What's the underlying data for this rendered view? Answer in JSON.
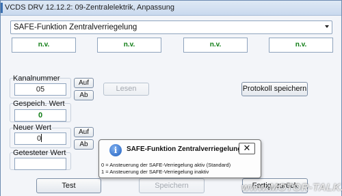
{
  "window": {
    "title": "VCDS DRV 12.12.2: 09-Zentralelektrik,  Anpassung"
  },
  "channel_select": {
    "value": "SAFE-Funktion Zentralverriegelung"
  },
  "nv_fields": [
    "n.v.",
    "n.v.",
    "n.v.",
    "n.v."
  ],
  "kanal": {
    "label": "Kanalnummer",
    "value": "05",
    "up_label": "Auf",
    "down_label": "Ab",
    "lesen_label": "Lesen"
  },
  "gespeich": {
    "label": "Gespeich. Wert",
    "value": "0"
  },
  "neuer": {
    "label": "Neuer Wert",
    "value": "0",
    "up_label": "Auf",
    "down_label": "Ab"
  },
  "getestet": {
    "label": "Getesteter Wert",
    "value": ""
  },
  "protokoll_label": "Protokoll speichern",
  "footer": {
    "test_label": "Test",
    "speichern_label": "Speichern",
    "fertig_label": "Fertig, zurück"
  },
  "tooltip": {
    "title": "SAFE-Funktion Zentralverriegelung",
    "close": "✕",
    "line1": "0 = Ansteuerung der SAFE-Verriegelung aktiv (Standard)",
    "line2": "1 = Ansteuerung der SAFE-Verriegelung inaktiv"
  },
  "watermark": "www.MOTOR-TALK.de",
  "colors": {
    "nv_green": "#0a7a10",
    "accent_blue": "#1f5fbf"
  }
}
